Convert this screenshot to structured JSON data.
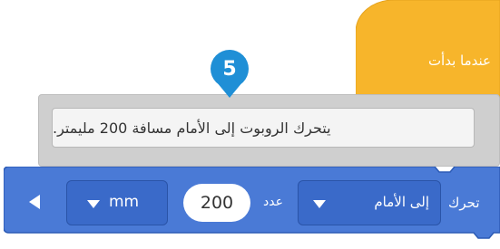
{
  "hat_block": {
    "label": "عندما بدأت",
    "color": "#f7b52b"
  },
  "badge": {
    "number": "5",
    "color": "#1f8fd6"
  },
  "comment": {
    "text": "يتحرك الروبوت إلى الأمام مسافة 200 مليمتر."
  },
  "move_block": {
    "label": "تحرك",
    "direction_value": "إلى الأمام",
    "count_label": "عدد",
    "distance_value": "200",
    "unit_value": "mm",
    "color": "#4a7ad6",
    "border_color": "#2c5bb5"
  },
  "icons": {
    "direction_dropdown": "caret-down-icon",
    "unit_dropdown": "caret-down-icon",
    "collapse": "caret-left-icon"
  }
}
